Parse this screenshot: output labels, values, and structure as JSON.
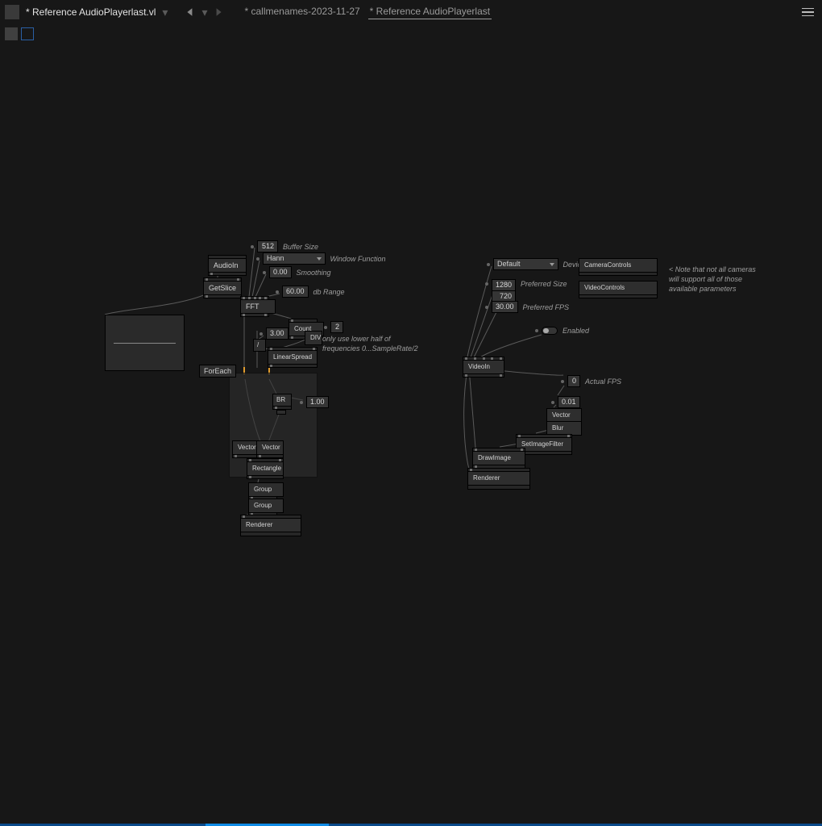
{
  "header": {
    "doc_title": "* Reference AudioPlayerlast.vl",
    "tab1": "* callmenames-2023-11-27",
    "tab2": "* Reference AudioPlayerlast"
  },
  "left": {
    "audioin": "AudioIn",
    "getslice": "GetSlice",
    "fft": "FFT",
    "buffer_size_val": "512",
    "buffer_size_lbl": "Buffer Size",
    "hann": "Hann",
    "window_fn_lbl": "Window Function",
    "smoothing_val": "0.00",
    "smoothing_lbl": "Smoothing",
    "db_range_val": "60.00",
    "db_range_lbl": "db Range",
    "count": "Count",
    "half_val": "2",
    "slash": "/",
    "three_val": "3.00",
    "div": "DIV",
    "linearspread": "LinearSpread",
    "comment_freq": "only use lower half of\nfrequencies 0...SampleRate/2",
    "foreach": "ForEach",
    "bit": "BR",
    "one_val": "1.00",
    "vector": "Vector",
    "rectangle": "Rectangle",
    "group": "Group",
    "renderer": "Renderer"
  },
  "right": {
    "default": "Default",
    "device_lbl": "Device",
    "cameracontrols": "CameraControls",
    "videocontrols": "VideoControls",
    "camera_comment": "< Note that not all cameras\nwill support all of those\navailable parameters",
    "pref_size_val1": "1280",
    "pref_size_val2": "720",
    "pref_size_lbl": "Preferred Size",
    "pref_fps_val": "30.00",
    "pref_fps_lbl": "Preferred FPS",
    "enabled_lbl": "Enabled",
    "videoin": "VideoIn",
    "actual_fps_val": "0",
    "actual_fps_lbl": "Actual FPS",
    "p01": "0.01",
    "vector": "Vector",
    "blur": "Blur",
    "setimagefilter": "SetImageFilter",
    "drawimage": "DrawImage",
    "renderer": "Renderer"
  }
}
